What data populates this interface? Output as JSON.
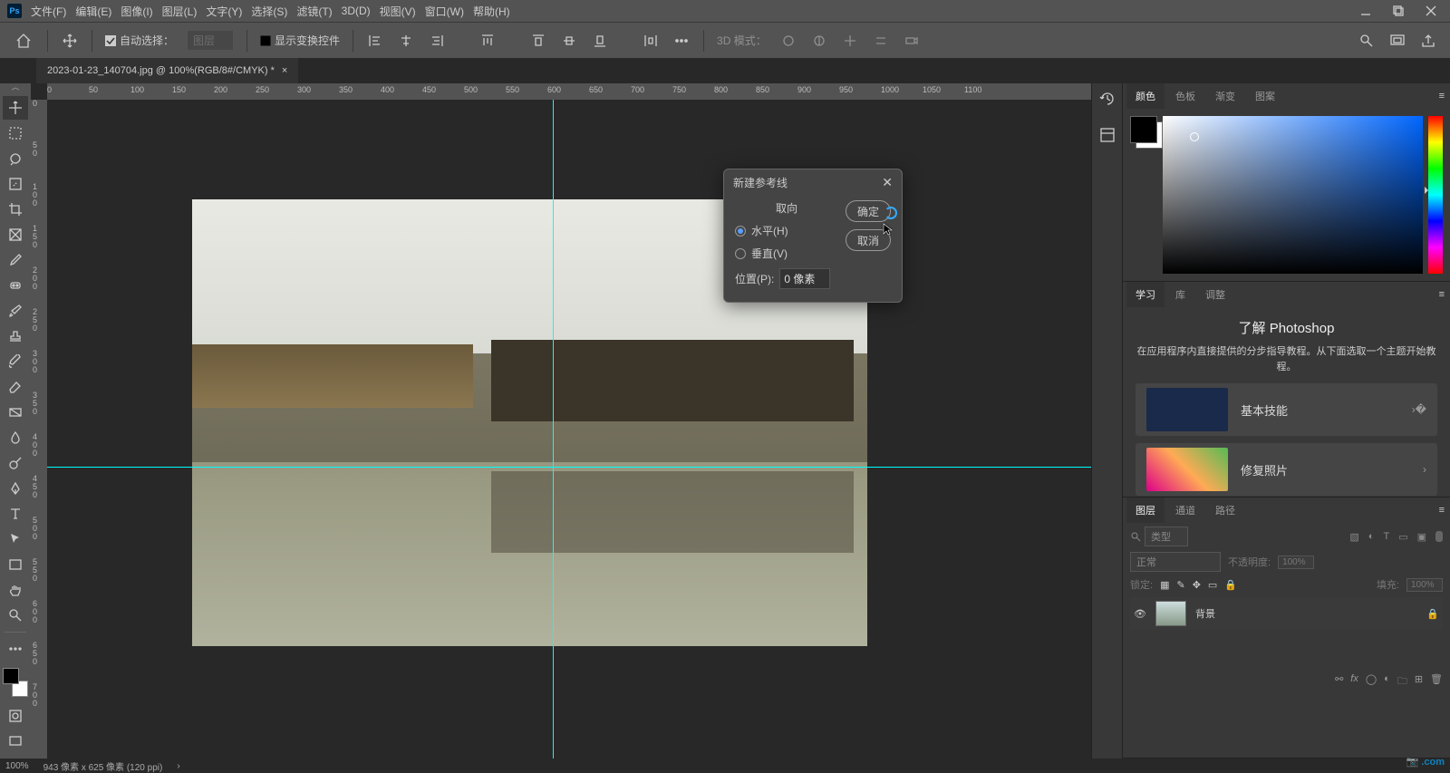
{
  "menu": {
    "items": [
      "文件(F)",
      "编辑(E)",
      "图像(I)",
      "图层(L)",
      "文字(Y)",
      "选择(S)",
      "滤镜(T)",
      "3D(D)",
      "视图(V)",
      "窗口(W)",
      "帮助(H)"
    ]
  },
  "options": {
    "auto_select_label": "自动选择：",
    "auto_select_value": "图层",
    "show_transform": "显示变换控件",
    "mode3d_label": "3D 模式："
  },
  "tab": {
    "title": "2023-01-23_140704.jpg @ 100%(RGB/8#/CMYK) *"
  },
  "ruler_h": [
    "0",
    "50",
    "100",
    "150",
    "200",
    "250",
    "300",
    "350",
    "400",
    "450",
    "500",
    "550",
    "600",
    "650",
    "700",
    "750",
    "800",
    "850",
    "900",
    "950",
    "1000",
    "1050",
    "1100"
  ],
  "ruler_v": [
    "0",
    "50",
    "100",
    "150",
    "200",
    "250",
    "300",
    "350",
    "400",
    "450",
    "500",
    "550",
    "600",
    "650",
    "700"
  ],
  "dialog": {
    "title": "新建参考线",
    "orientation_label": "取向",
    "horizontal": "水平(H)",
    "vertical": "垂直(V)",
    "position_label": "位置(P):",
    "position_value": "0 像素",
    "ok": "确定",
    "cancel": "取消"
  },
  "panels": {
    "color": {
      "tabs": [
        "颜色",
        "色板",
        "渐变",
        "图案"
      ]
    },
    "learn": {
      "tabs": [
        "学习",
        "库",
        "调整"
      ],
      "heading": "了解 Photoshop",
      "desc": "在应用程序内直接提供的分步指导教程。从下面选取一个主题开始教程。",
      "cards": [
        "基本技能",
        "修复照片"
      ]
    },
    "layers": {
      "tabs": [
        "图层",
        "通道",
        "路径"
      ],
      "kind_label": "类型",
      "blend": "正常",
      "opacity_label": "不透明度:",
      "opacity_value": "100%",
      "lock_label": "锁定:",
      "fill_label": "填充:",
      "fill_value": "100%",
      "layer_name": "背景"
    }
  },
  "status": {
    "zoom": "100%",
    "info": "943 像素 x 625 像素 (120 ppi)"
  },
  "tools": [
    "move",
    "rect-marquee",
    "lasso",
    "magic-wand",
    "crop",
    "frame",
    "eyedropper",
    "heal",
    "brush",
    "stamp",
    "history-brush",
    "eraser",
    "gradient",
    "blur",
    "dodge",
    "pen",
    "type",
    "path-select",
    "rectangle",
    "hand",
    "zoom",
    "edit-toolbar"
  ]
}
